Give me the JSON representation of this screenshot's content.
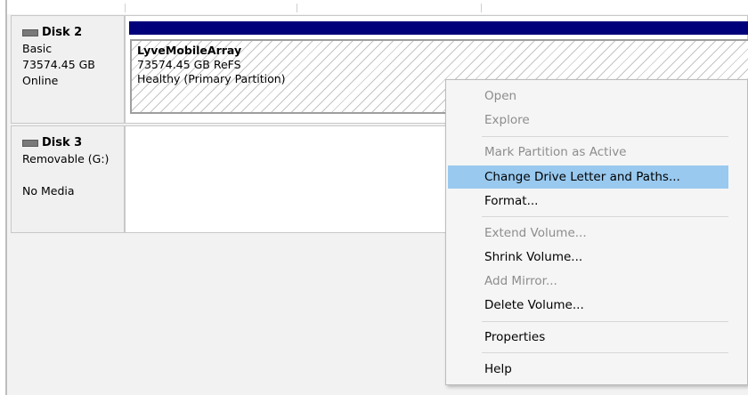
{
  "disks": [
    {
      "title": "Disk 2",
      "type": "Basic",
      "size": "73574.45 GB",
      "status": "Online",
      "partition": {
        "name": "LyveMobileArray",
        "size_fs": "73574.45 GB ReFS",
        "health": "Healthy (Primary Partition)"
      }
    },
    {
      "title": "Disk 3",
      "type": "Removable (G:)",
      "media": "No Media"
    }
  ],
  "context_menu": {
    "items": [
      {
        "label": "Open",
        "enabled": false
      },
      {
        "label": "Explore",
        "enabled": false
      },
      {
        "label": "Mark Partition as Active",
        "enabled": false
      },
      {
        "label": "Change Drive Letter and Paths...",
        "enabled": true,
        "highlighted": true
      },
      {
        "label": "Format...",
        "enabled": true
      },
      {
        "label": "Extend Volume...",
        "enabled": false
      },
      {
        "label": "Shrink Volume...",
        "enabled": true
      },
      {
        "label": "Add Mirror...",
        "enabled": false
      },
      {
        "label": "Delete Volume...",
        "enabled": true
      },
      {
        "label": "Properties",
        "enabled": true
      },
      {
        "label": "Help",
        "enabled": true
      }
    ]
  },
  "colors": {
    "partition_bar": "#00007a",
    "highlight": "#99c9ef",
    "disabled_text": "#8d8d8d"
  }
}
